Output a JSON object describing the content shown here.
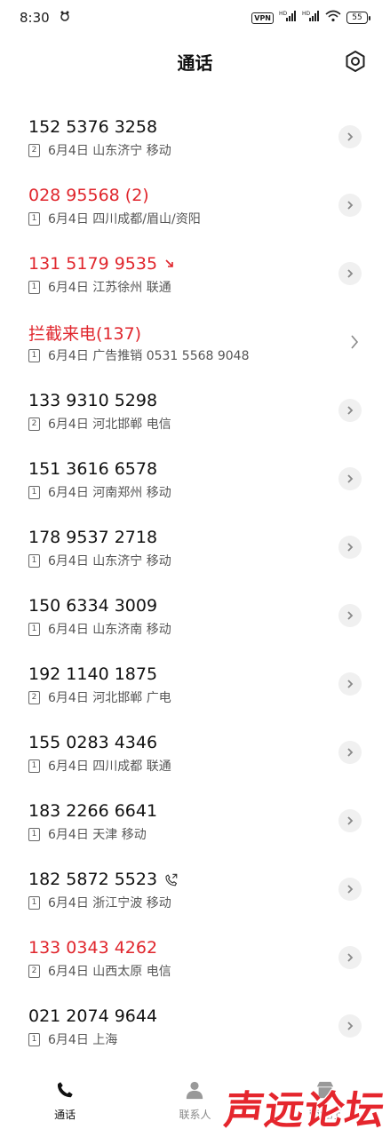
{
  "status_bar": {
    "time": "8:30",
    "vpn": "VPN",
    "battery": "55"
  },
  "header": {
    "title": "通话"
  },
  "calls": [
    {
      "number": "152 5376 3258",
      "missed": false,
      "sim": "2",
      "detail": "6月4日 山东济宁 移动",
      "marker": ""
    },
    {
      "number": "028 95568 (2)",
      "missed": true,
      "sim": "1",
      "detail": "6月4日 四川成都/眉山/资阳",
      "marker": ""
    },
    {
      "number": "131 5179 9535",
      "missed": true,
      "sim": "1",
      "detail": "6月4日 江苏徐州 联通",
      "marker": "missed-arrow"
    },
    {
      "number": "拦截来电(137)",
      "missed": true,
      "sim": "1",
      "detail": "6月4日 广告推销 0531 5568 9048",
      "marker": ""
    },
    {
      "number": "133 9310 5298",
      "missed": false,
      "sim": "2",
      "detail": "6月4日 河北邯郸 电信",
      "marker": ""
    },
    {
      "number": "151 3616 6578",
      "missed": false,
      "sim": "1",
      "detail": "6月4日 河南郑州 移动",
      "marker": ""
    },
    {
      "number": "178 9537 2718",
      "missed": false,
      "sim": "1",
      "detail": "6月4日 山东济宁 移动",
      "marker": ""
    },
    {
      "number": "150 6334 3009",
      "missed": false,
      "sim": "1",
      "detail": "6月4日 山东济南 移动",
      "marker": ""
    },
    {
      "number": "192 1140 1875",
      "missed": false,
      "sim": "2",
      "detail": "6月4日 河北邯郸 广电",
      "marker": ""
    },
    {
      "number": "155 0283 4346",
      "missed": false,
      "sim": "1",
      "detail": "6月4日 四川成都 联通",
      "marker": ""
    },
    {
      "number": "183 2266 6641",
      "missed": false,
      "sim": "1",
      "detail": "6月4日 天津 移动",
      "marker": ""
    },
    {
      "number": "182 5872 5523",
      "missed": false,
      "sim": "1",
      "detail": "6月4日 浙江宁波 移动",
      "marker": "outgoing-call"
    },
    {
      "number": "133 0343 4262",
      "missed": true,
      "sim": "2",
      "detail": "6月4日 山西太原 电信",
      "marker": ""
    },
    {
      "number": "021 2074 9644",
      "missed": false,
      "sim": "1",
      "detail": "6月4日 上海",
      "marker": ""
    }
  ],
  "bottom_nav": {
    "calls": "通话",
    "contacts": "联系人",
    "third": "营业厅"
  },
  "watermark": "声远论坛",
  "colors": {
    "missed": "#e0262d",
    "normal": "#111111",
    "watermark": "#e5262d"
  }
}
